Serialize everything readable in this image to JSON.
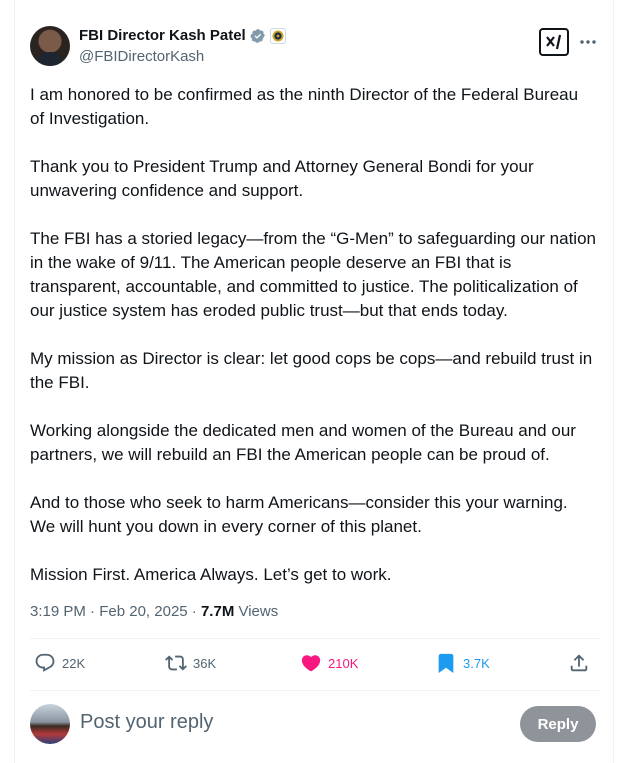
{
  "post": {
    "author": {
      "display_name": "FBI Director Kash Patel",
      "handle": "@FBIDirectorKash",
      "verified": true,
      "affiliation_badge": "fbi-seal-icon"
    },
    "paragraphs": [
      "I am honored to be confirmed as the ninth Director of the Federal Bureau of Investigation.",
      "Thank you to President Trump and Attorney General Bondi for your unwavering confidence and support.",
      "The FBI has a storied legacy—from the “G-Men” to safeguarding our nation in the wake of 9/11. The American people deserve an FBI that is transparent, accountable, and committed to justice. The politicalization of our justice system has eroded public trust—but that ends today.",
      "My mission as Director is clear: let good cops be cops—and rebuild trust in the FBI.",
      "Working alongside the dedicated men and women of the Bureau and our partners, we will rebuild an FBI the American people can be proud of.",
      "And to those who seek to harm Americans—consider this your warning. We will hunt you down in every corner of this planet.",
      "Mission First. America Always. Let’s get to work."
    ],
    "time": "3:19 PM",
    "separator": " · ",
    "date": "Feb 20, 2025",
    "views_count": "7.7M",
    "views_label": " Views"
  },
  "actions": {
    "replies": "22K",
    "reposts": "36K",
    "likes": "210K",
    "bookmarks": "3.7K"
  },
  "reply_box": {
    "placeholder": "Post your reply",
    "button_label": "Reply"
  },
  "colors": {
    "text": "#0f1419",
    "secondary": "#536471",
    "like": "#f91880",
    "bookmark": "#1d9bf0",
    "verified": "#829aab",
    "reply_button": "#8e9499"
  }
}
